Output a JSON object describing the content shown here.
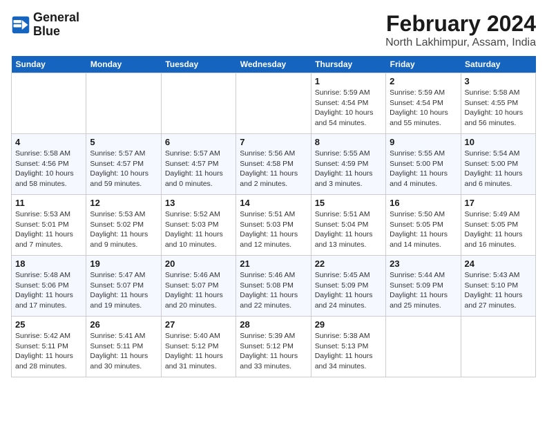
{
  "header": {
    "logo_line1": "General",
    "logo_line2": "Blue",
    "title": "February 2024",
    "subtitle": "North Lakhimpur, Assam, India"
  },
  "days_of_week": [
    "Sunday",
    "Monday",
    "Tuesday",
    "Wednesday",
    "Thursday",
    "Friday",
    "Saturday"
  ],
  "weeks": [
    [
      {
        "day": "",
        "detail": ""
      },
      {
        "day": "",
        "detail": ""
      },
      {
        "day": "",
        "detail": ""
      },
      {
        "day": "",
        "detail": ""
      },
      {
        "day": "1",
        "detail": "Sunrise: 5:59 AM\nSunset: 4:54 PM\nDaylight: 10 hours\nand 54 minutes."
      },
      {
        "day": "2",
        "detail": "Sunrise: 5:59 AM\nSunset: 4:54 PM\nDaylight: 10 hours\nand 55 minutes."
      },
      {
        "day": "3",
        "detail": "Sunrise: 5:58 AM\nSunset: 4:55 PM\nDaylight: 10 hours\nand 56 minutes."
      }
    ],
    [
      {
        "day": "4",
        "detail": "Sunrise: 5:58 AM\nSunset: 4:56 PM\nDaylight: 10 hours\nand 58 minutes."
      },
      {
        "day": "5",
        "detail": "Sunrise: 5:57 AM\nSunset: 4:57 PM\nDaylight: 10 hours\nand 59 minutes."
      },
      {
        "day": "6",
        "detail": "Sunrise: 5:57 AM\nSunset: 4:57 PM\nDaylight: 11 hours\nand 0 minutes."
      },
      {
        "day": "7",
        "detail": "Sunrise: 5:56 AM\nSunset: 4:58 PM\nDaylight: 11 hours\nand 2 minutes."
      },
      {
        "day": "8",
        "detail": "Sunrise: 5:55 AM\nSunset: 4:59 PM\nDaylight: 11 hours\nand 3 minutes."
      },
      {
        "day": "9",
        "detail": "Sunrise: 5:55 AM\nSunset: 5:00 PM\nDaylight: 11 hours\nand 4 minutes."
      },
      {
        "day": "10",
        "detail": "Sunrise: 5:54 AM\nSunset: 5:00 PM\nDaylight: 11 hours\nand 6 minutes."
      }
    ],
    [
      {
        "day": "11",
        "detail": "Sunrise: 5:53 AM\nSunset: 5:01 PM\nDaylight: 11 hours\nand 7 minutes."
      },
      {
        "day": "12",
        "detail": "Sunrise: 5:53 AM\nSunset: 5:02 PM\nDaylight: 11 hours\nand 9 minutes."
      },
      {
        "day": "13",
        "detail": "Sunrise: 5:52 AM\nSunset: 5:03 PM\nDaylight: 11 hours\nand 10 minutes."
      },
      {
        "day": "14",
        "detail": "Sunrise: 5:51 AM\nSunset: 5:03 PM\nDaylight: 11 hours\nand 12 minutes."
      },
      {
        "day": "15",
        "detail": "Sunrise: 5:51 AM\nSunset: 5:04 PM\nDaylight: 11 hours\nand 13 minutes."
      },
      {
        "day": "16",
        "detail": "Sunrise: 5:50 AM\nSunset: 5:05 PM\nDaylight: 11 hours\nand 14 minutes."
      },
      {
        "day": "17",
        "detail": "Sunrise: 5:49 AM\nSunset: 5:05 PM\nDaylight: 11 hours\nand 16 minutes."
      }
    ],
    [
      {
        "day": "18",
        "detail": "Sunrise: 5:48 AM\nSunset: 5:06 PM\nDaylight: 11 hours\nand 17 minutes."
      },
      {
        "day": "19",
        "detail": "Sunrise: 5:47 AM\nSunset: 5:07 PM\nDaylight: 11 hours\nand 19 minutes."
      },
      {
        "day": "20",
        "detail": "Sunrise: 5:46 AM\nSunset: 5:07 PM\nDaylight: 11 hours\nand 20 minutes."
      },
      {
        "day": "21",
        "detail": "Sunrise: 5:46 AM\nSunset: 5:08 PM\nDaylight: 11 hours\nand 22 minutes."
      },
      {
        "day": "22",
        "detail": "Sunrise: 5:45 AM\nSunset: 5:09 PM\nDaylight: 11 hours\nand 24 minutes."
      },
      {
        "day": "23",
        "detail": "Sunrise: 5:44 AM\nSunset: 5:09 PM\nDaylight: 11 hours\nand 25 minutes."
      },
      {
        "day": "24",
        "detail": "Sunrise: 5:43 AM\nSunset: 5:10 PM\nDaylight: 11 hours\nand 27 minutes."
      }
    ],
    [
      {
        "day": "25",
        "detail": "Sunrise: 5:42 AM\nSunset: 5:11 PM\nDaylight: 11 hours\nand 28 minutes."
      },
      {
        "day": "26",
        "detail": "Sunrise: 5:41 AM\nSunset: 5:11 PM\nDaylight: 11 hours\nand 30 minutes."
      },
      {
        "day": "27",
        "detail": "Sunrise: 5:40 AM\nSunset: 5:12 PM\nDaylight: 11 hours\nand 31 minutes."
      },
      {
        "day": "28",
        "detail": "Sunrise: 5:39 AM\nSunset: 5:12 PM\nDaylight: 11 hours\nand 33 minutes."
      },
      {
        "day": "29",
        "detail": "Sunrise: 5:38 AM\nSunset: 5:13 PM\nDaylight: 11 hours\nand 34 minutes."
      },
      {
        "day": "",
        "detail": ""
      },
      {
        "day": "",
        "detail": ""
      }
    ]
  ]
}
